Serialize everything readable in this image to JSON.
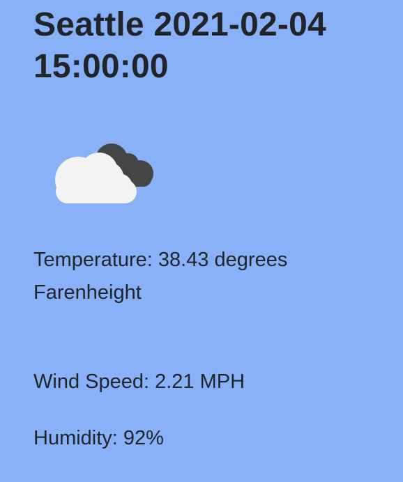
{
  "header": {
    "title": "Seattle 2021-02-04 15:00:00"
  },
  "weather": {
    "icon": "partly-cloudy-dark-cloud-icon",
    "temperature": "Temperature: 38.43 degrees Farenheight",
    "wind_speed": "Wind Speed: 2.21 MPH",
    "humidity": "Humidity: 92%"
  },
  "colors": {
    "background": "#89b1f7",
    "text": "#212529",
    "light_cloud": "#f3f3f3",
    "dark_cloud": "#454545"
  }
}
